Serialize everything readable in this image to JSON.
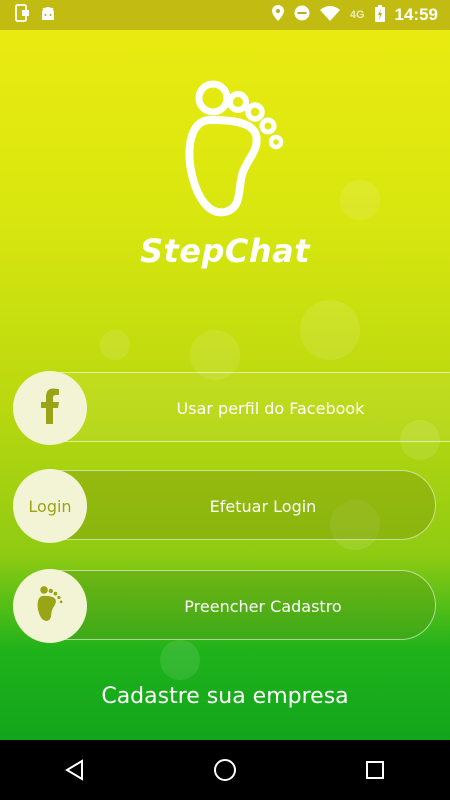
{
  "status_bar": {
    "network": "4G",
    "time": "14:59"
  },
  "app": {
    "brand": "StepChat"
  },
  "buttons": {
    "facebook_label": "Usar perfil do Facebook",
    "login_circle_text": "Login",
    "login_label": "Efetuar Login",
    "register_label": "Preencher Cadastro"
  },
  "footer": {
    "company_link": "Cadastre sua empresa"
  },
  "colors": {
    "accent": "#9aa417",
    "circle_bg": "#f3f4d6",
    "text": "#ffffff"
  },
  "icons": {
    "logo": "footprint-icon",
    "facebook": "facebook-icon",
    "register": "footprint-icon"
  }
}
